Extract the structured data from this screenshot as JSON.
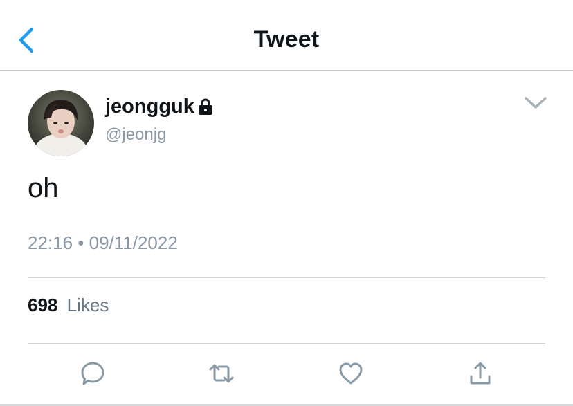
{
  "header": {
    "title": "Tweet",
    "back_icon": "chevron-left-icon",
    "accent_color": "#1d9bf0"
  },
  "tweet": {
    "display_name": "jeongguk",
    "protected_icon": "lock-icon",
    "handle": "@jeonjg",
    "text": "oh",
    "timestamp": "22:16 • 09/11/2022",
    "likes_count": "698",
    "likes_label": "Likes",
    "menu_icon": "chevron-down-icon"
  },
  "actions": [
    {
      "name": "reply",
      "icon": "reply-icon"
    },
    {
      "name": "retweet",
      "icon": "retweet-icon"
    },
    {
      "name": "like",
      "icon": "heart-icon"
    },
    {
      "name": "share",
      "icon": "share-icon"
    }
  ],
  "colors": {
    "text_primary": "#0f1419",
    "text_secondary": "#8b98a5",
    "icon_gray": "#8899a6",
    "divider": "#cfd3d6"
  }
}
